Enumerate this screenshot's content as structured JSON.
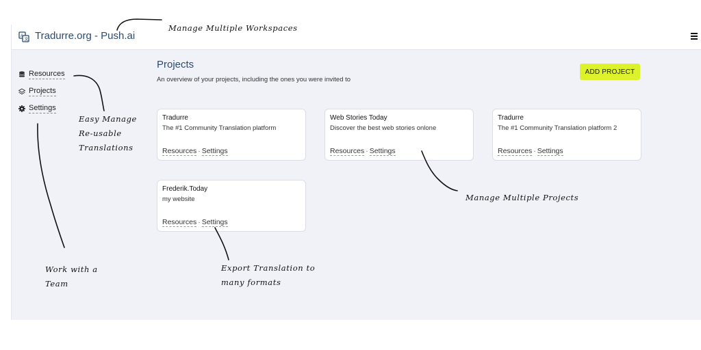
{
  "header": {
    "brand_title": "Tradurre.org - Push.ai"
  },
  "sidebar": {
    "items": [
      {
        "label": "Resources",
        "icon": "database-icon"
      },
      {
        "label": "Projects",
        "icon": "layers-icon"
      },
      {
        "label": "Settings",
        "icon": "gear-icon"
      }
    ]
  },
  "main": {
    "title": "Projects",
    "subtitle": "An overview of your projects, including the ones you were invited to",
    "add_button_label": "ADD PROJECT",
    "projects": [
      {
        "title": "Tradurre",
        "description": "The #1 Community Translation platform",
        "resources_label": "Resources",
        "settings_label": "Settings"
      },
      {
        "title": "Web Stories Today",
        "description": "Discover the best web stories onlone",
        "resources_label": "Resources",
        "settings_label": "Settings"
      },
      {
        "title": "Tradurre",
        "description": "The #1 Community Translation platform 2",
        "resources_label": "Resources",
        "settings_label": "Settings"
      },
      {
        "title": "Frederik.Today",
        "description": "my website",
        "resources_label": "Resources",
        "settings_label": "Settings"
      }
    ]
  },
  "annotations": {
    "workspaces": "Manage Multiple Workspaces",
    "translations": [
      "Easy Manage",
      "Re-usable",
      "Translations"
    ],
    "projects": "Manage Multiple Projects",
    "export": [
      "Export Translation to",
      "many formats"
    ],
    "team": [
      "Work with a",
      "Team"
    ]
  },
  "colors": {
    "accent_button": "#dcf22a",
    "title_blue": "#2b4a6f",
    "page_bg": "#f1f1f8"
  }
}
